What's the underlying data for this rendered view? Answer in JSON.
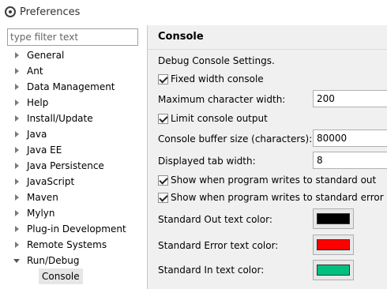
{
  "window": {
    "title": "Preferences",
    "icon": "eclipse-icon"
  },
  "sidebar": {
    "filter_placeholder": "type filter text",
    "items": [
      {
        "label": "General"
      },
      {
        "label": "Ant"
      },
      {
        "label": "Data Management"
      },
      {
        "label": "Help"
      },
      {
        "label": "Install/Update"
      },
      {
        "label": "Java"
      },
      {
        "label": "Java EE"
      },
      {
        "label": "Java Persistence"
      },
      {
        "label": "JavaScript"
      },
      {
        "label": "Maven"
      },
      {
        "label": "Mylyn"
      },
      {
        "label": "Plug-in Development"
      },
      {
        "label": "Remote Systems"
      },
      {
        "label": "Run/Debug",
        "expanded": true
      }
    ],
    "selected_child": "Console"
  },
  "page": {
    "title": "Console",
    "description": "Debug Console Settings.",
    "fixed_width": {
      "label": "Fixed width console",
      "checked": true
    },
    "max_char_width": {
      "label": "Maximum character width:",
      "value": "200"
    },
    "limit_output": {
      "label": "Limit console output",
      "checked": true
    },
    "buffer_size": {
      "label": "Console buffer size (characters):",
      "value": "80000"
    },
    "tab_width": {
      "label": "Displayed tab width:",
      "value": "8"
    },
    "show_std_out": {
      "label": "Show when program writes to standard out",
      "checked": true
    },
    "show_std_err": {
      "label": "Show when program writes to standard error",
      "checked": true
    },
    "std_out_color": {
      "label": "Standard Out text color:",
      "color": "#000000"
    },
    "std_err_color": {
      "label": "Standard Error text color:",
      "color": "#ff0000"
    },
    "std_in_color": {
      "label": "Standard In text color:",
      "color": "#00c080"
    }
  }
}
